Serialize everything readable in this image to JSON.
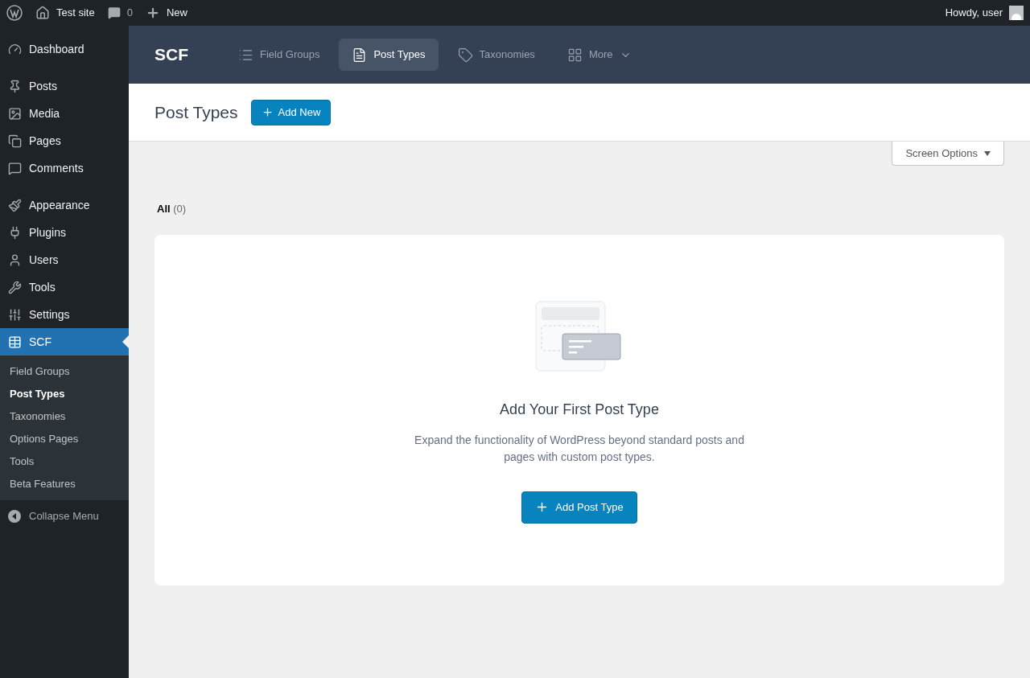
{
  "admin_bar": {
    "site": "Test site",
    "comments": "0",
    "new": "New",
    "greeting": "Howdy, user"
  },
  "sidebar": {
    "groups": [
      [
        {
          "label": "Dashboard",
          "selected": false
        }
      ],
      [
        {
          "label": "Posts",
          "selected": false
        },
        {
          "label": "Media",
          "selected": false
        },
        {
          "label": "Pages",
          "selected": false
        },
        {
          "label": "Comments",
          "selected": false
        }
      ],
      [
        {
          "label": "Appearance",
          "selected": false
        },
        {
          "label": "Plugins",
          "selected": false
        },
        {
          "label": "Users",
          "selected": false
        },
        {
          "label": "Tools",
          "selected": false
        },
        {
          "label": "Settings",
          "selected": false
        },
        {
          "label": "SCF",
          "selected": true
        }
      ]
    ],
    "submenu": [
      {
        "label": "Field Groups",
        "selected": false
      },
      {
        "label": "Post Types",
        "selected": true
      },
      {
        "label": "Taxonomies",
        "selected": false
      },
      {
        "label": "Options Pages",
        "selected": false
      },
      {
        "label": "Tools",
        "selected": false
      },
      {
        "label": "Beta Features",
        "selected": false
      }
    ],
    "collapse": "Collapse Menu"
  },
  "plugin_nav": {
    "logo": "SCF",
    "tabs": [
      {
        "label": "Field Groups",
        "selected": false
      },
      {
        "label": "Post Types",
        "selected": true
      },
      {
        "label": "Taxonomies",
        "selected": false
      },
      {
        "label": "More",
        "selected": false
      }
    ]
  },
  "header": {
    "title": "Post Types",
    "add_button": "Add New"
  },
  "screen_options": "Screen Options",
  "filters": [
    {
      "label": "All",
      "count": "(0)",
      "selected": true
    }
  ],
  "empty_state": {
    "title": "Add Your First Post Type",
    "description": "Expand the functionality of WordPress beyond standard posts and pages with custom post types.",
    "button": "Add Post Type"
  }
}
